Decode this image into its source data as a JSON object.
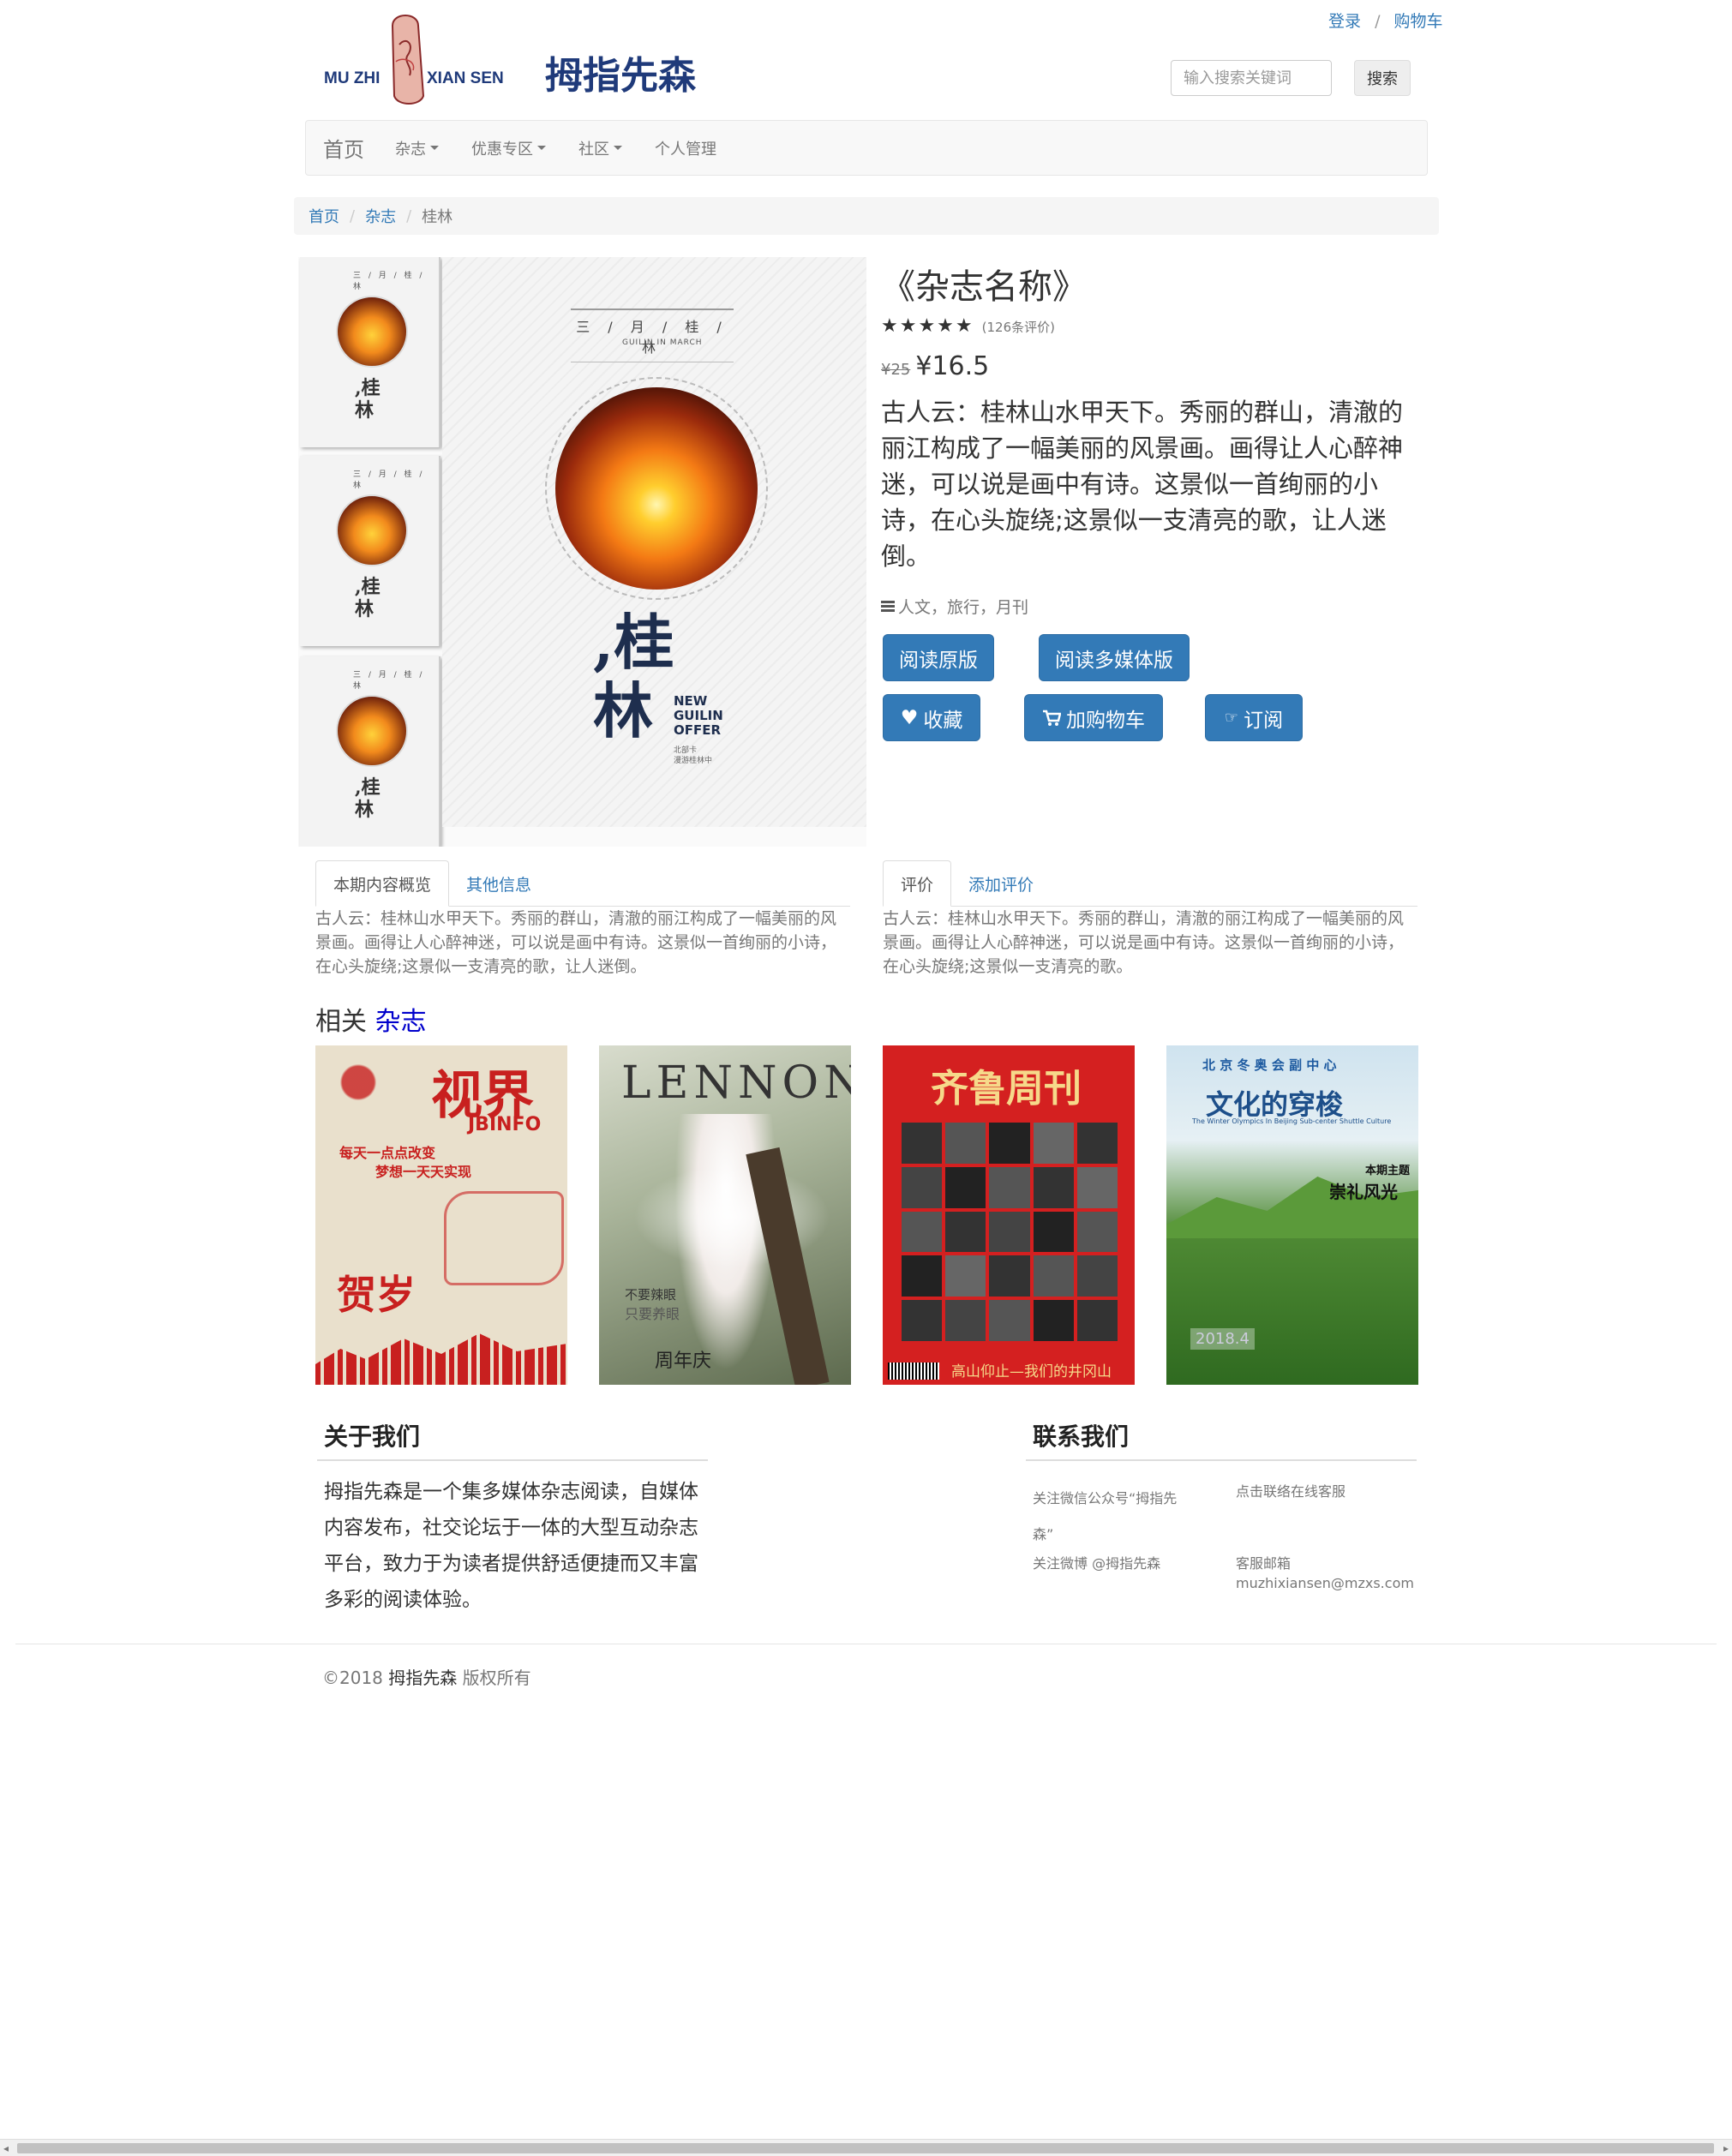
{
  "header": {
    "login": "登录",
    "sep": "/",
    "cart": "购物车",
    "logo_en_left": "MU ZHI",
    "logo_en_right": "XIAN SEN",
    "logo_text": "拇指先森",
    "search_placeholder": "输入搜索关键词",
    "search_button": "搜索"
  },
  "nav": {
    "home": "首页",
    "items": [
      "杂志",
      "优惠专区",
      "社区",
      "个人管理"
    ]
  },
  "breadcrumb": [
    "首页",
    "杂志",
    "桂林"
  ],
  "cover": {
    "header": "三 / 月 / 桂 / 林",
    "sub": "GUILIN IN MARCH",
    "zh": ",桂\n林",
    "en": "NEW\nGUILIN\nOFFER",
    "en2": "北部卡\n漫游桂林中"
  },
  "product": {
    "title": "《杂志名称》",
    "stars": "★★★★★",
    "review_count": "(126条评价)",
    "old_price": "¥25",
    "price": "¥16.5",
    "description": "古人云：桂林山水甲天下。秀丽的群山，清澈的丽江构成了一幅美丽的风景画。画得让人心醉神迷，可以说是画中有诗。这景似一首绚丽的小诗，在心头旋绕;这景似一支清亮的歌，让人迷倒。",
    "tags": "人文，旅行，月刊",
    "buttons": {
      "read_original": "阅读原版",
      "read_multimedia": "阅读多媒体版",
      "favorite": "收藏",
      "add_cart": "加购物车",
      "subscribe": "订阅"
    }
  },
  "tabs_left": {
    "active": "本期内容概览",
    "other": "其他信息",
    "content": "古人云：桂林山水甲天下。秀丽的群山，清澈的丽江构成了一幅美丽的风景画。画得让人心醉神迷，可以说是画中有诗。这景似一首绚丽的小诗，在心头旋绕;这景似一支清亮的歌，让人迷倒。"
  },
  "tabs_right": {
    "active": "评价",
    "other": "添加评价",
    "content": "古人云：桂林山水甲天下。秀丽的群山，清澈的丽江构成了一幅美丽的风景画。画得让人心醉神迷，可以说是画中有诗。这景似一首绚丽的小诗，在心头旋绕;这景似一支清亮的歌。"
  },
  "related": {
    "prefix": "相关",
    "highlight": "杂志",
    "magazines": [
      {
        "title": "视界",
        "sub": "JBINFO",
        "line1": "每天一点点改变",
        "line2": "梦想一天天实现",
        "bottom": "贺岁"
      },
      {
        "title": "LENNON",
        "line1": "不要辣眼",
        "line2": "只要养眼",
        "bottom": "周年庆"
      },
      {
        "title": "齐鲁周刊",
        "bottom": "高山仰止—我们的井冈山"
      },
      {
        "title": "文化的穿梭",
        "top": "北 京 冬 奥 会 副 中 心",
        "sub": "The Winter Olympics In Beijing Sub-center Shuttle Culture",
        "topic": "本期主题",
        "topic2": "崇礼风光",
        "date": "2018.4"
      }
    ]
  },
  "footer": {
    "about_title": "关于我们",
    "about_text": "拇指先森是一个集多媒体杂志阅读，自媒体内容发布，社交论坛于一体的大型互动杂志平台，致力于为读者提供舒适便捷而又丰富多彩的阅读体验。",
    "contact_title": "联系我们",
    "wechat": "关注微信公众号“拇指先森”",
    "online_service": "点击联络在线客服",
    "weibo": "关注微博 @拇指先森",
    "email_label": "客服邮箱",
    "email": "muzhixiansen@mzxs.com",
    "copyright_prefix": "©2018",
    "copyright_brand": "拇指先森",
    "copyright_suffix": "版权所有"
  }
}
